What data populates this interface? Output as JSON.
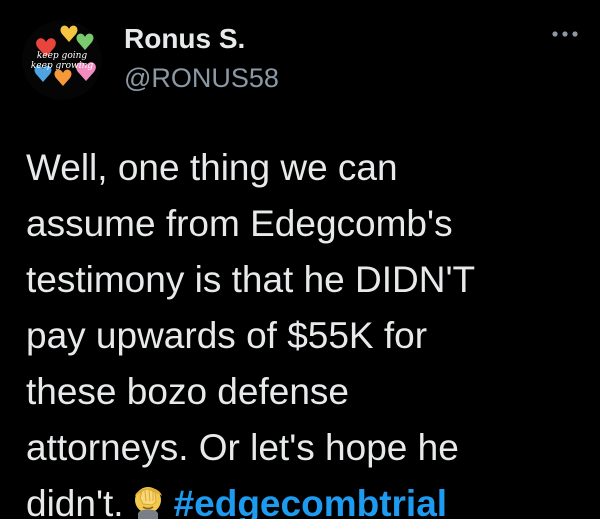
{
  "user": {
    "display_name": "Ronus S.",
    "handle": "@RONUS58",
    "avatar_text_line1": "keep going",
    "avatar_text_line2": "keep growing"
  },
  "tweet": {
    "text_line1": "Well, one thing we can",
    "text_line2": "assume from Edegcomb's",
    "text_line3": "testimony is that he DIDN'T",
    "text_line4": "pay upwards of $55K for",
    "text_line5": "these bozo defense",
    "text_line6": "attorneys. Or let's hope he",
    "text_line7_prefix": "didn't.",
    "emoji": "face-palm-emoji",
    "hashtag": "#edgecombtrial"
  },
  "colors": {
    "background": "#000000",
    "text": "#e7e9ea",
    "secondary": "#8b98a5",
    "link": "#1d9bf0"
  },
  "icons": {
    "more": "more-options-icon"
  }
}
